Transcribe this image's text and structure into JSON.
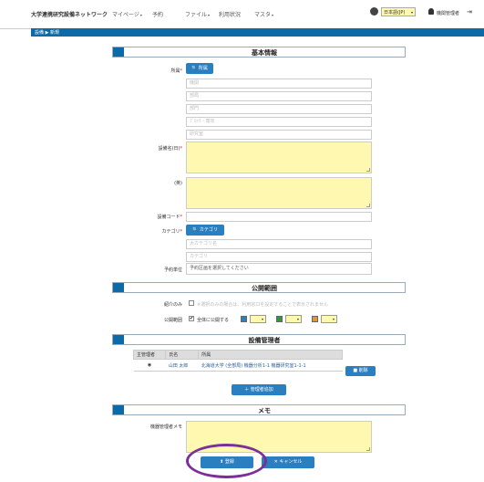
{
  "navbar": {
    "brand": "大学連携研究設備ネットワーク",
    "menus": [
      {
        "label": "マイページ",
        "caret": "▾"
      },
      {
        "label": "予約",
        "caret": ""
      },
      {
        "label": "ファイル",
        "caret": "▾"
      },
      {
        "label": "利用状況",
        "caret": ""
      },
      {
        "label": "マスタ",
        "caret": "▾"
      }
    ],
    "language": "日本語(JP)",
    "user": "機関管理者",
    "logout_glyph": "⇥"
  },
  "breadcrumb": "設備 ▶ 新規",
  "basic_info": {
    "title": "基本情報",
    "affiliation_label": "所属",
    "affiliation_button": "所属",
    "affiliation_placeholders": [
      "機関",
      "部局",
      "部門",
      "ﾌﾞﾛｯｸ・専攻",
      "研究室"
    ],
    "equipment_name_label": "設備名(日)",
    "equipment_name_en_label": "(英)",
    "equipment_code_label": "設備コード",
    "category_label": "カテゴリ",
    "category_button": "カテゴリ",
    "category_placeholders": [
      "大カテゴリ名",
      "カテゴリ"
    ],
    "reservation_label": "予約単位",
    "reservation_value": "予約区画を選択してください"
  },
  "publication": {
    "title": "公開範囲",
    "intro_label": "紹介のみ",
    "intro_text": "※選択のみの場合は、利用窓口を設定することで表示されません",
    "scope_label": "公開範囲",
    "scope_check": "✔",
    "scope_text": "全体に公開する"
  },
  "manager": {
    "title": "設備管理者",
    "columns": [
      "主管理者",
      "氏名",
      "所属"
    ],
    "row": {
      "name": "山田 太郎",
      "org": "北海道大学 (全部局) 機器分析1-1 機器研究室1-1-1"
    },
    "delete_button": "削除",
    "add_button": "管理者追加"
  },
  "memo": {
    "title": "メモ",
    "label": "機器管理者メモ"
  },
  "actions": {
    "register": "登録",
    "cancel": "キャンセル"
  }
}
